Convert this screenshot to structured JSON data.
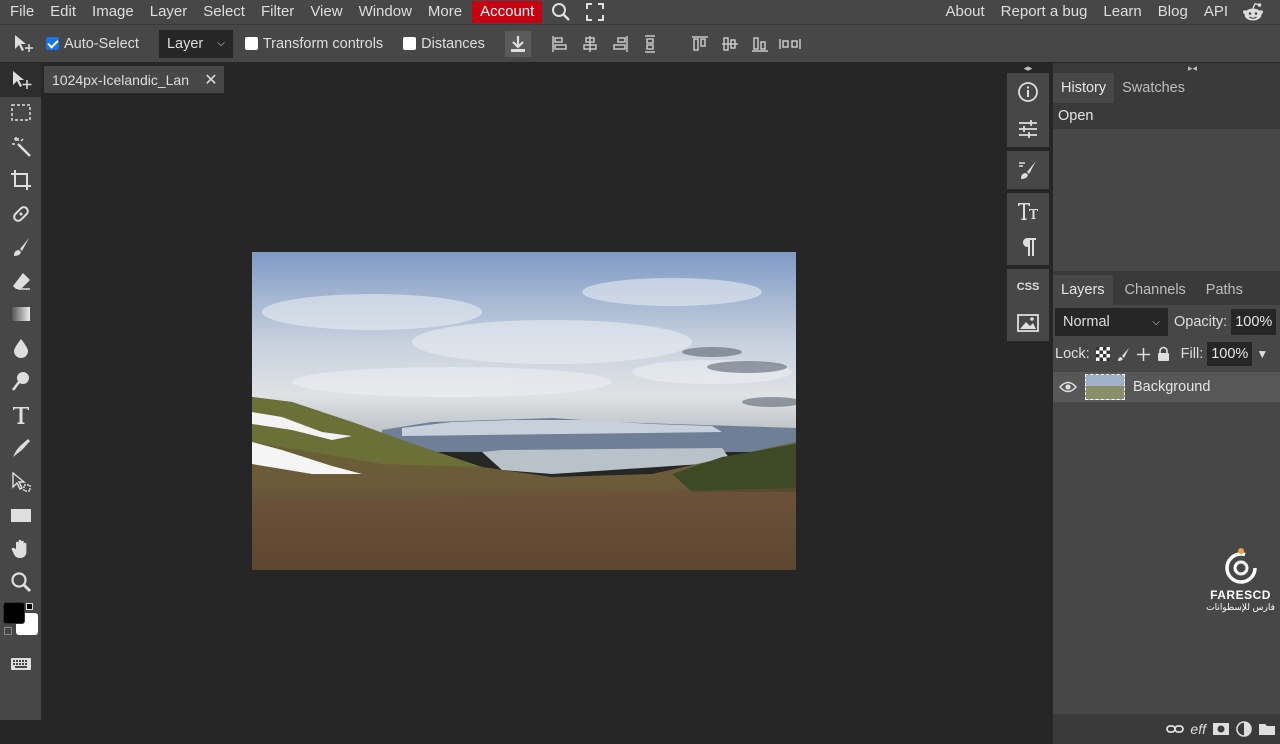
{
  "menu": {
    "items": [
      "File",
      "Edit",
      "Image",
      "Layer",
      "Select",
      "Filter",
      "View",
      "Window",
      "More"
    ],
    "account": "Account",
    "right": [
      "About",
      "Report a bug",
      "Learn",
      "Blog",
      "API"
    ]
  },
  "options": {
    "auto_select": "Auto-Select",
    "layer_dropdown": "Layer",
    "transform_controls": "Transform controls",
    "distances": "Distances"
  },
  "document": {
    "tab_title": "1024px-Icelandic_Lan",
    "close": "✕"
  },
  "mini": {
    "css_label": "CSS"
  },
  "history_panel": {
    "tabs": [
      "History",
      "Swatches"
    ],
    "entries": [
      "Open"
    ]
  },
  "layers_panel": {
    "tabs": [
      "Layers",
      "Channels",
      "Paths"
    ],
    "blend_mode": "Normal",
    "opacity_label": "Opacity:",
    "opacity_value": "100%",
    "lock_label": "Lock:",
    "fill_label": "Fill:",
    "fill_value": "100%",
    "layers": [
      {
        "name": "Background"
      }
    ]
  },
  "watermark": {
    "name": "FARESCD",
    "subtitle": "فارس للإسطوانات"
  },
  "colors": {
    "accent": "#c8000f",
    "checkbox": "#1a73e8",
    "panel": "#474747",
    "workspace": "#262626"
  }
}
